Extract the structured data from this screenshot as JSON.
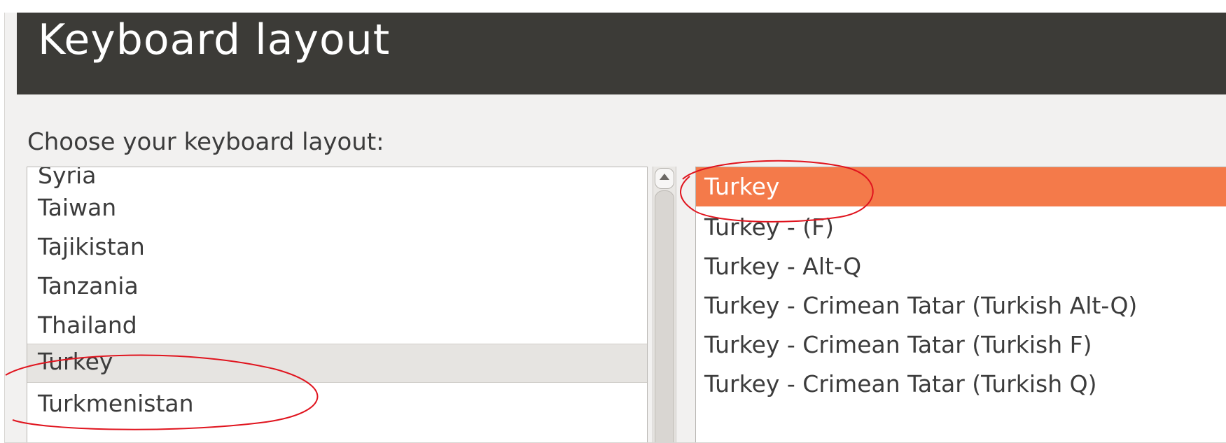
{
  "header": {
    "title": "Keyboard layout"
  },
  "prompt": "Choose your keyboard layout:",
  "countries": {
    "items": [
      {
        "label": "Syria"
      },
      {
        "label": "Taiwan"
      },
      {
        "label": "Tajikistan"
      },
      {
        "label": "Tanzania"
      },
      {
        "label": "Thailand"
      },
      {
        "label": "Turkey"
      },
      {
        "label": "Turkmenistan"
      }
    ],
    "selected": "Turkey"
  },
  "variants": {
    "items": [
      {
        "label": "Turkey"
      },
      {
        "label": "Turkey - (F)"
      },
      {
        "label": "Turkey - Alt-Q"
      },
      {
        "label": "Turkey - Crimean Tatar (Turkish Alt-Q)"
      },
      {
        "label": "Turkey - Crimean Tatar (Turkish F)"
      },
      {
        "label": "Turkey - Crimean Tatar (Turkish Q)"
      }
    ],
    "selected": "Turkey"
  },
  "icons": {
    "scroll_up": "chevron-up-icon"
  },
  "colors": {
    "header_bg": "#3c3b37",
    "selection_accent": "#f47a4a",
    "annotation_ellipse": "#e0141e"
  }
}
